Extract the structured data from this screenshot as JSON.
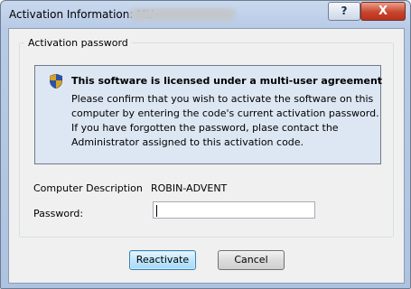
{
  "window": {
    "title": "Activation Information: MU",
    "help_label": "?",
    "close_label": "X"
  },
  "group": {
    "label": "Activation password"
  },
  "info": {
    "heading": "This software is licensed under a multi-user agreement",
    "lines": [
      "Please confirm that you wish to activate the software on this",
      "computer by entering the code's current activation password.",
      "If you have forgotten the password, plase contact the",
      "Administrator assigned to this activation code."
    ]
  },
  "form": {
    "computer_description_label": "Computer Description",
    "computer_description_value": "ROBIN-ADVENT",
    "password_label": "Password:",
    "password_value": ""
  },
  "buttons": {
    "reactivate": "Reactivate",
    "cancel": "Cancel"
  },
  "colors": {
    "info_background": "#dde6f3",
    "frame": "#b8cbe6",
    "close_button": "#c8442c"
  }
}
